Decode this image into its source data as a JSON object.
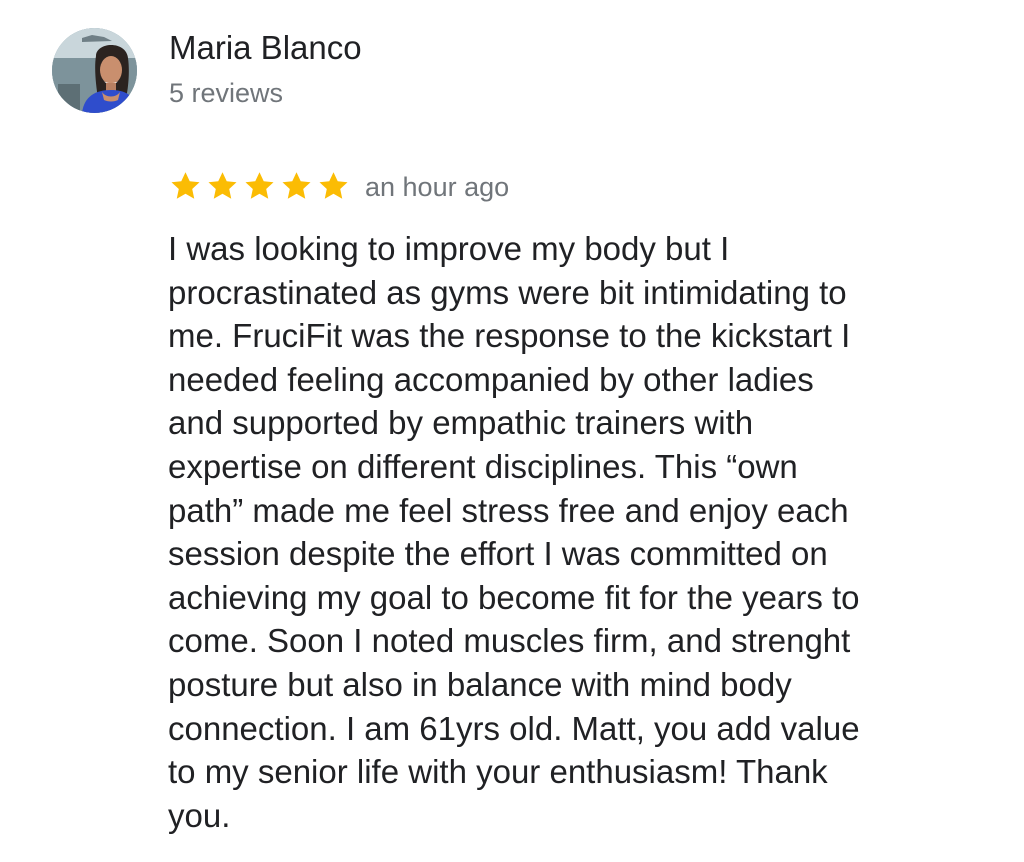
{
  "reviewer": {
    "name": "Maria Blanco",
    "review_count": "5 reviews",
    "avatar_icon": "profile-photo"
  },
  "review": {
    "rating": 5,
    "rating_max": 5,
    "star_color": "#fbbc04",
    "time": "an hour ago",
    "text": "I was looking to improve my body but I\nprocrastinated as gyms were bit intimidating to\nme. FruciFit was the response to the kickstart I\nneeded feeling accompanied by other ladies\nand supported by empathic trainers with\nexpertise on different disciplines. This “own\npath” made me feel stress free and enjoy each\nsession despite the effort I was committed on\nachieving my goal to become fit for the years to\ncome. Soon I noted muscles firm, and strenght\nposture but also in balance with mind body\nconnection. I am 61yrs old. Matt, you add value\nto my senior life  with your enthusiasm! Thank\nyou."
  }
}
